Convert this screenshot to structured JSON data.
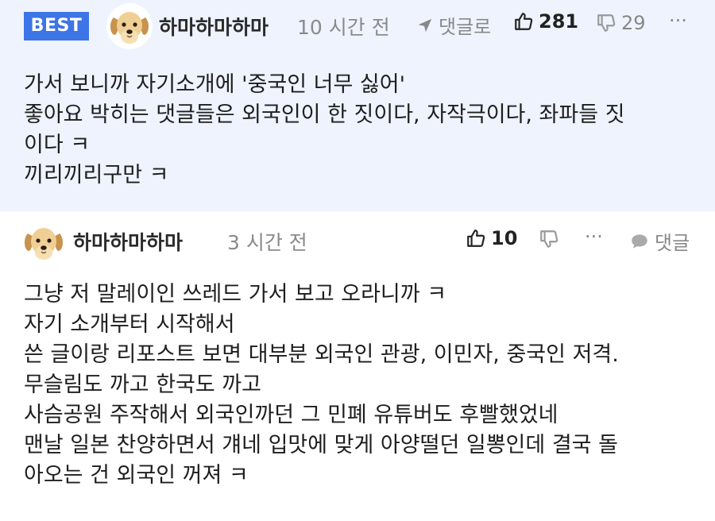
{
  "best_comment": {
    "badge": "BEST",
    "author": "하마하마하마",
    "time": "10 시간 전",
    "reply_label": "댓글로",
    "likes": "281",
    "dislikes": "29",
    "more": "···",
    "lines": [
      "가서 보니까 자기소개에 '중국인 너무 싫어'",
      "좋아요 박히는 댓글들은 외국인이 한 짓이다, 자작극이다, 좌파들 짓",
      "이다 ㅋ",
      "끼리끼리구만 ㅋ"
    ]
  },
  "reply": {
    "author": "하마하마하마",
    "time": "3 시간 전",
    "likes": "10",
    "more": "···",
    "reply_label": "댓글",
    "lines": [
      "그냥 저 말레이인 쓰레드 가서 보고 오라니까 ㅋ",
      "자기 소개부터 시작해서",
      "쓴 글이랑 리포스트 보면 대부분 외국인 관광, 이민자, 중국인 저격.",
      "무슬림도 까고 한국도 까고",
      "사슴공원 주작해서 외국인까던 그 민폐 유튜버도 후빨했었네",
      "맨날 일본 찬양하면서 걔네 입맛에 맞게 아양떨던 일뽕인데 결국 돌",
      "아오는 건 외국인 꺼져 ㅋ"
    ]
  },
  "colors": {
    "best_bg": "#eef3fe",
    "badge_bg": "#3d74e6",
    "muted": "#8a8a8a"
  }
}
